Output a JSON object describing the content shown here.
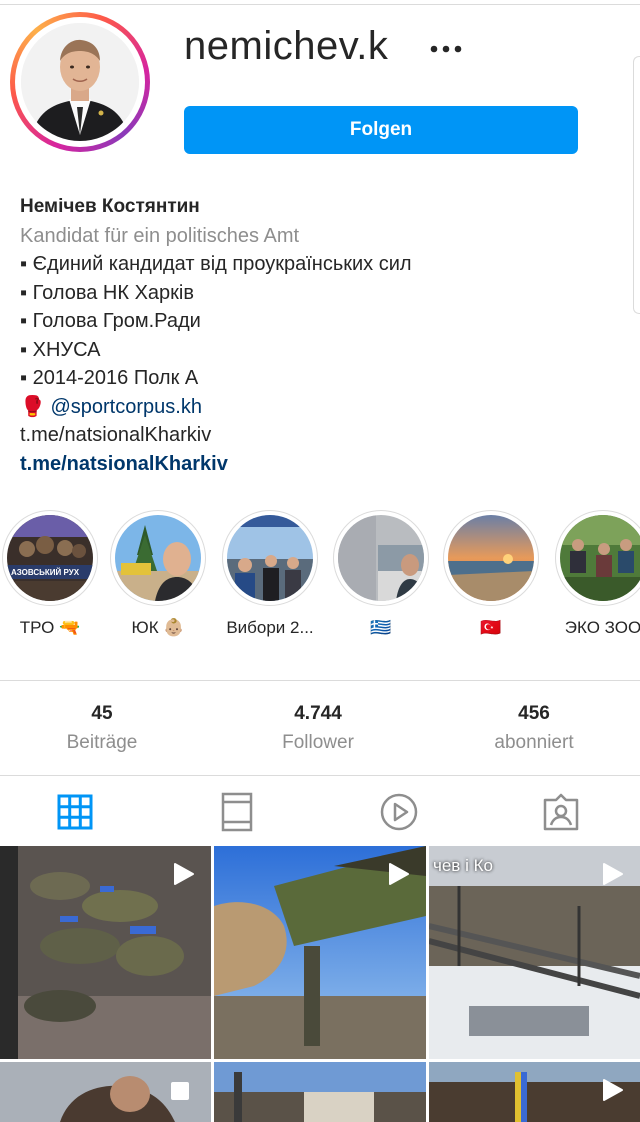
{
  "profile": {
    "username": "nemichev.k",
    "follow_label": "Folgen",
    "display_name": "Немічев Костянтин",
    "category": "Kandidat für ein politisches Amt",
    "bio_lines": [
      "▪ Єдиний кандидат від проукраїнських сил",
      "▪  Голова НК Харків",
      "▪  Голова Гром.Ради",
      "▪ ХНУСА",
      "▪  2014-2016 Полк А"
    ],
    "mention_emoji": "🥊",
    "mention": "@sportcorpus.kh",
    "link_plain": "t.me/natsionalKharkiv",
    "link_bold": "t.me/natsionalKharkiv"
  },
  "highlights": [
    {
      "label": "ТРО 🔫",
      "cover_text": "АЗОВСЬКИЙ РУХ"
    },
    {
      "label": "ЮК 👶🏼"
    },
    {
      "label": "Вибори 2..."
    },
    {
      "label": "🇬🇷"
    },
    {
      "label": "🇹🇷"
    },
    {
      "label": "ЭКО ЗОО"
    }
  ],
  "stats": {
    "posts": {
      "value": "45",
      "label": "Beiträge"
    },
    "followers": {
      "value": "4.744",
      "label": "Follower"
    },
    "following": {
      "value": "456",
      "label": "abonniert"
    }
  },
  "grid": {
    "post3_caption": "чев і Ко"
  },
  "colors": {
    "accent": "#0095f6",
    "text": "#262626",
    "secondary": "#8e8e8e",
    "link": "#00376b",
    "divider": "#dbdbdb"
  },
  "icons": [
    "more-icon",
    "grid-icon",
    "feed-icon",
    "reels-icon",
    "tagged-icon",
    "reel-play-icon",
    "multi-post-icon"
  ]
}
